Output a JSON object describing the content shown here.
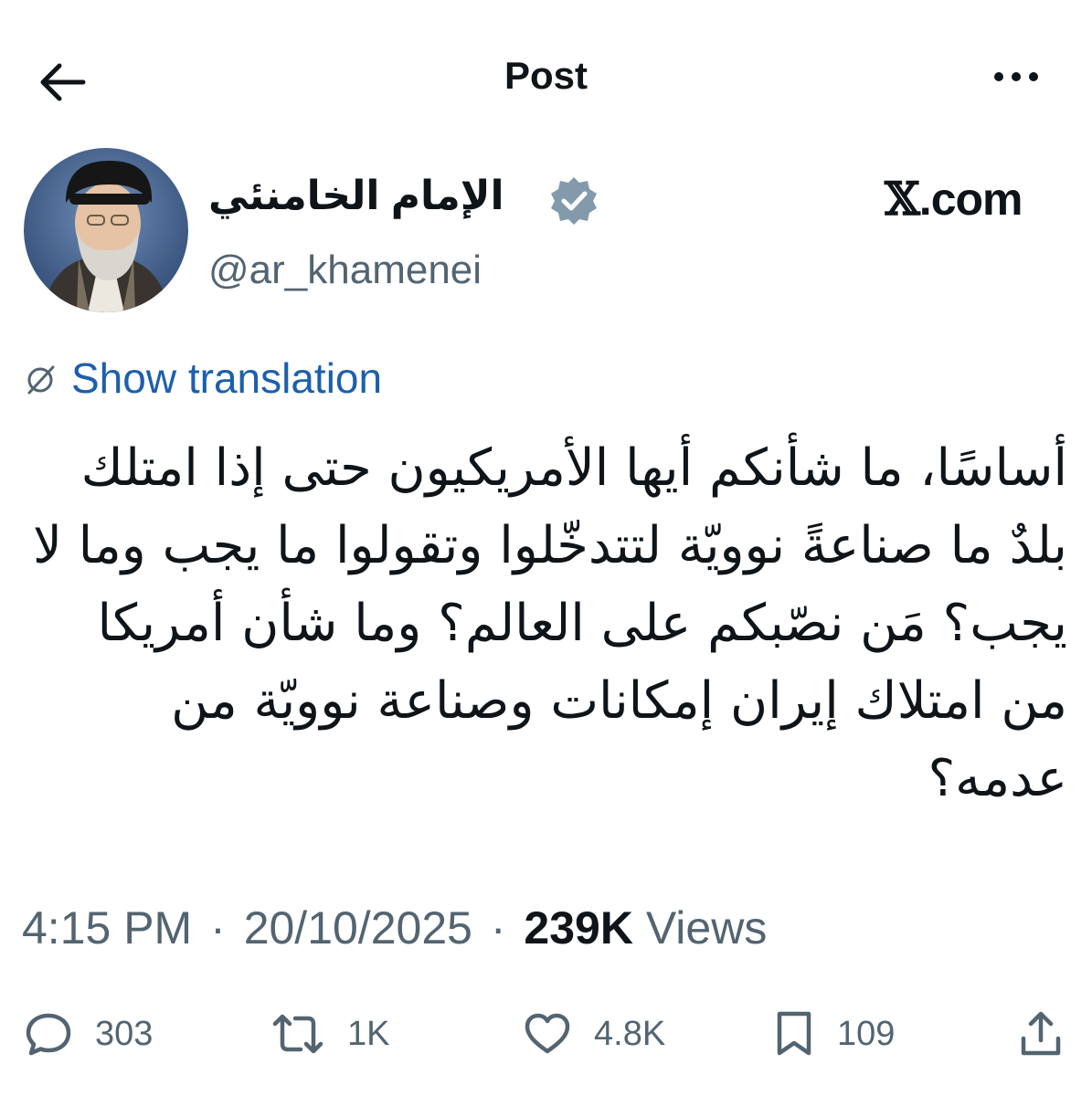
{
  "header": {
    "title": "Post",
    "back_icon": "arrow-left-icon",
    "more_icon": "more-horizontal-icon"
  },
  "author": {
    "display_name": "الإمام الخامنئي",
    "handle": "@ar_khamenei",
    "verified_icon": "verified-badge-icon",
    "badge_color": "#829aab"
  },
  "watermark": {
    "x_letter": "𝕏",
    "domain": ".com"
  },
  "translation": {
    "label": "Show translation",
    "icon": "globe-slash-icon",
    "color": "#1d5fae"
  },
  "tweet": {
    "text": "أساسًا، ما شأنكم أيها الأمريكيون حتى إذا امتلك بلدٌ ما صناعةً نوويّة لتتدخّلوا وتقولوا ما يجب وما لا يجب؟ مَن نصّبكم على العالم؟ وما شأن أمريكا من امتلاك إيران إمكانات وصناعة نوويّة من عدمه؟",
    "time": "4:15 PM",
    "separator": "·",
    "date": "20/10/2025",
    "views_count": "239K",
    "views_label": "Views"
  },
  "actions": {
    "replies": "303",
    "reposts": "1K",
    "likes": "4.8K",
    "bookmarks": "109"
  }
}
